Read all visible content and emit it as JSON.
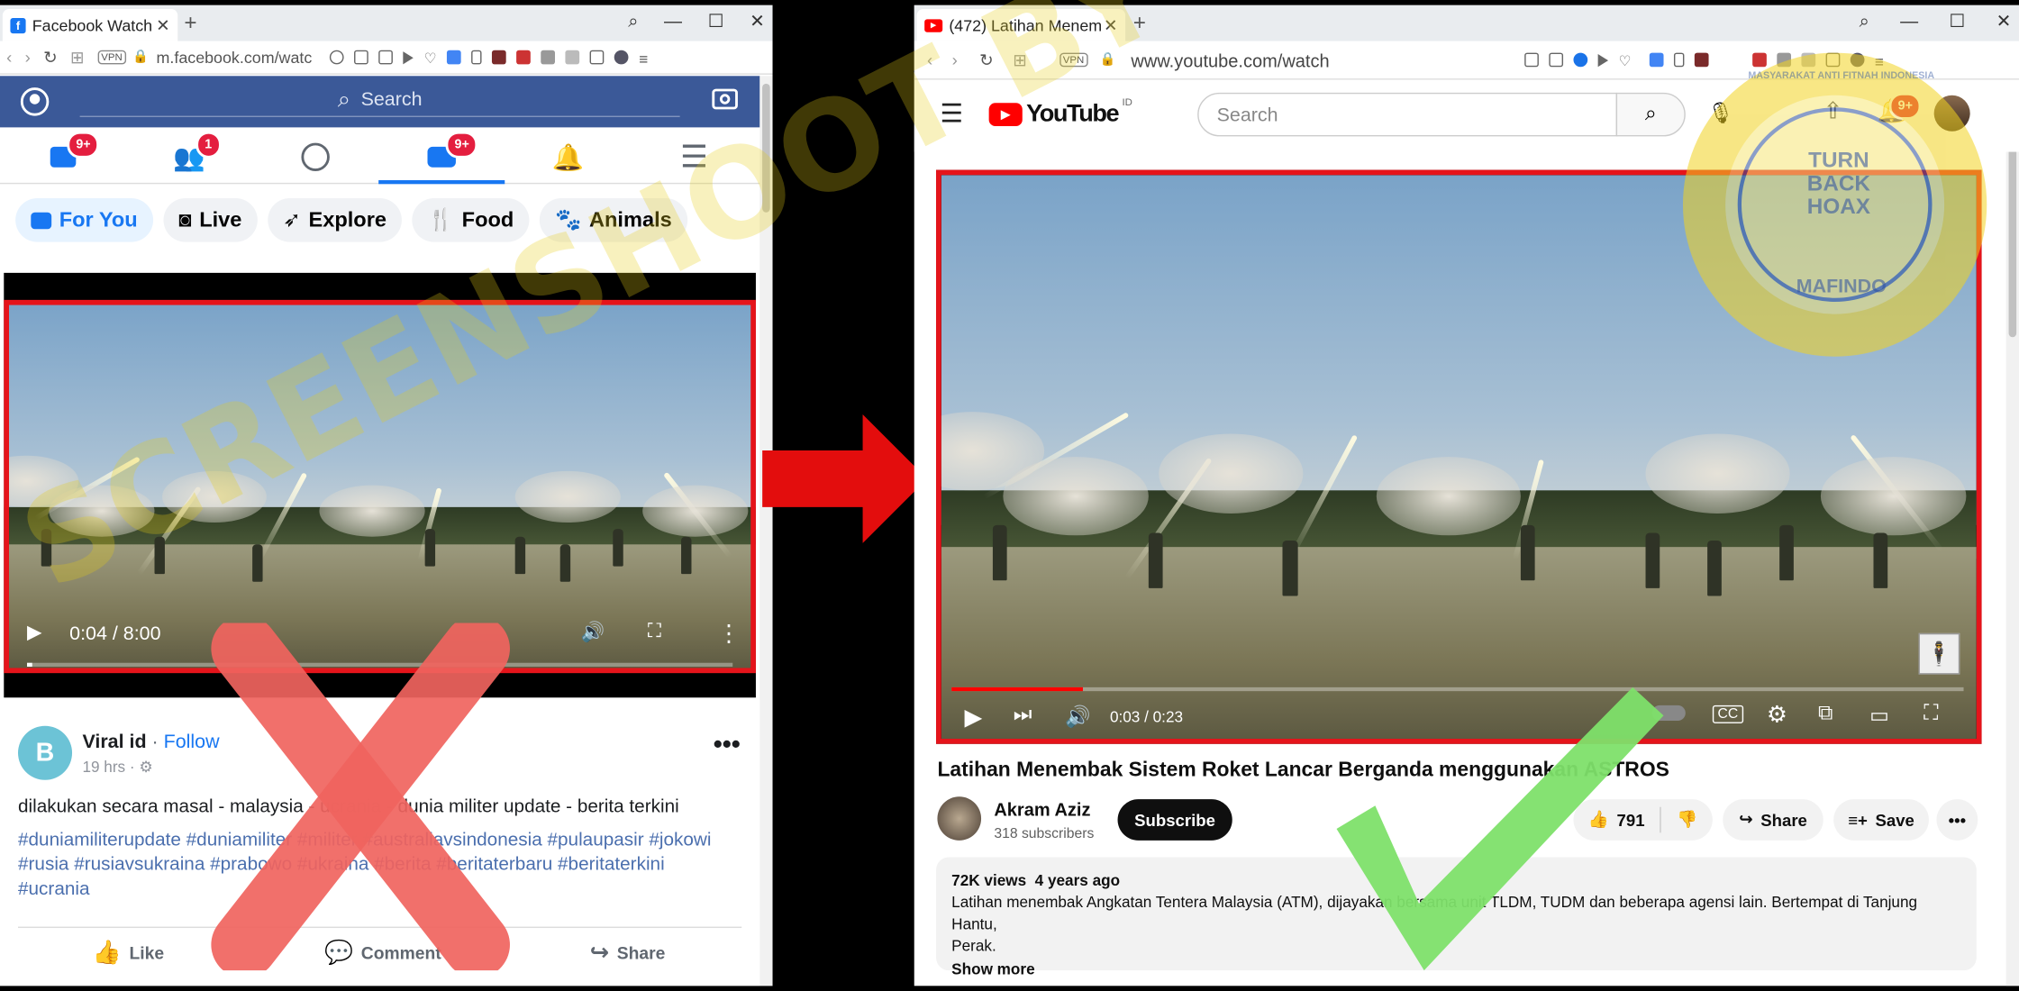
{
  "facebook": {
    "tab_title": "Facebook Watch",
    "url": "m.facebook.com/watc",
    "search_placeholder": "Search",
    "nav_badges": {
      "feed": "9+",
      "friends": "1",
      "watch": "9+"
    },
    "chips": [
      "For You",
      "Live",
      "Explore",
      "Food",
      "Animals"
    ],
    "video_time": "0:04 / 8:00",
    "video_progress": 0.008,
    "post": {
      "author": "Viral id",
      "follow": "Follow",
      "time": "19 hrs",
      "avatar_letter": "B",
      "caption": "dilakukan secara masal - malaysia - ucrania - dunia militer update - berita terkini",
      "hashtags_line1": "#duniamiliterupdate #duniamiliter #militer #australiavsindonesia #pulaupasir #jokowi",
      "hashtags_line2": "#rusia #rusiavsukraina #prabowo #ukraina #berita #beritaterbaru #beritaterkini",
      "hashtags_line3": "#ucrania",
      "actions": [
        "Like",
        "Comment",
        "Share"
      ]
    }
  },
  "youtube": {
    "tab_title": "(472) Latihan Menem",
    "url": "www.youtube.com/watch",
    "brand": "YouTube",
    "region": "ID",
    "search_placeholder": "Search",
    "notif_badge": "9+",
    "video_time": "0:03 / 0:23",
    "video_progress": 0.13,
    "title": "Latihan Menembak Sistem Roket Lancar Berganda menggunakan ASTROS",
    "channel": "Akram Aziz",
    "subscribers": "318 subscribers",
    "subscribe": "Subscribe",
    "likes": "791",
    "share": "Share",
    "save": "Save",
    "views": "72K views",
    "age": "4 years ago",
    "description_line1": "Latihan menembak Angkatan Tentera Malaysia (ATM), dijayakan bersama unit TLDM, TUDM dan beberapa agensi lain. Bertempat di Tanjung Hantu,",
    "description_line2": "Perak.",
    "show_more": "Show more"
  },
  "overlay": {
    "watermark": "SCREENSHOOT BY",
    "stamp_top": "TURN BACK HOAX",
    "stamp_ring": "MASYARAKAT ANTI FITNAH INDONESIA",
    "stamp_bottom": "MAFINDO"
  },
  "colors": {
    "facebook_blue": "#3b5998",
    "highlight_red": "#e5141b",
    "cross_red": "#f0645f",
    "check_green": "#7ee06a",
    "stamp_yellow": "#f2d321"
  }
}
